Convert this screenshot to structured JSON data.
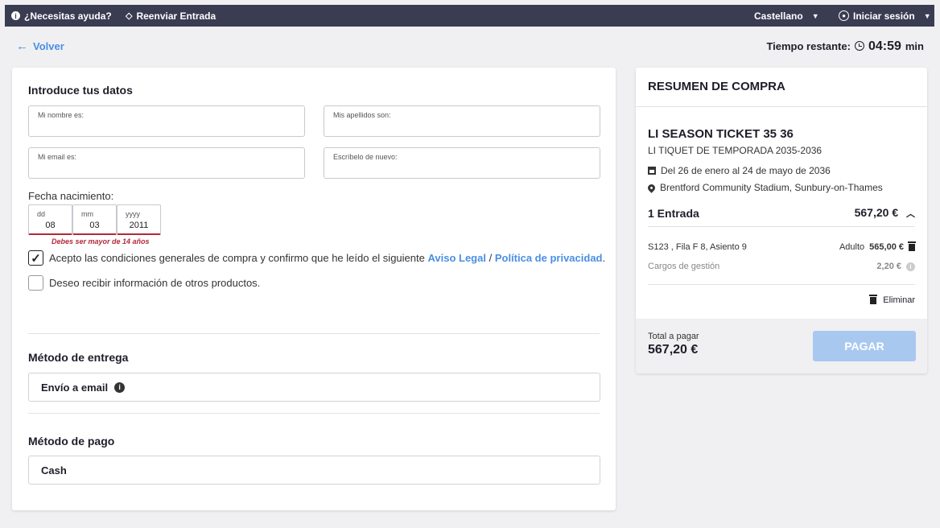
{
  "topbar": {
    "help": "¿Necesitas ayuda?",
    "resend": "Reenviar Entrada",
    "language": "Castellano",
    "login": "Iniciar sesión"
  },
  "nav": {
    "back": "Volver",
    "timer_label": "Tiempo restante:",
    "timer_value": "04:59",
    "timer_unit": "min"
  },
  "form": {
    "title": "Introduce tus datos",
    "first_name_label": "Mi nombre es:",
    "last_name_label": "Mis apellidos son:",
    "email_label": "Mi email es:",
    "email_confirm_label": "Escríbelo de nuevo:",
    "dob_label": "Fecha nacimiento:",
    "dob": {
      "day_label": "dd",
      "day": "08",
      "month_label": "mm",
      "month": "03",
      "year_label": "yyyy",
      "year": "2011"
    },
    "dob_error": "Debes ser mayor de 14 años",
    "terms_text": "Acepto las condiciones generales de compra y confirmo que he leído el siguiente",
    "terms_link_legal": "Aviso Legal",
    "terms_sep": "/",
    "terms_link_privacy": "Política de privacidad",
    "terms_end": ".",
    "newsletter_text": "Deseo recibir información de otros productos."
  },
  "delivery": {
    "title": "Método de entrega",
    "option": "Envío a email"
  },
  "payment": {
    "title": "Método de pago",
    "option": "Cash"
  },
  "summary": {
    "header": "RESUMEN DE COMPRA",
    "event_title": "LI SEASON TICKET 35 36",
    "event_subtitle": "LI TIQUET DE TEMPORADA 2035-2036",
    "dates": "Del 26 de enero al 24 de mayo de 2036",
    "venue": "Brentford Community Stadium, Sunbury-on-Thames",
    "tickets_label": "1 Entrada",
    "tickets_total": "567,20 €",
    "seat": "S123 , Fila F 8, Asiento 9",
    "seat_type": "Adulto",
    "seat_price": "565,00 €",
    "fees_label": "Cargos de gestión",
    "fees_value": "2,20 €",
    "remove": "Eliminar",
    "total_label": "Total a pagar",
    "total_value": "567,20 €",
    "pay_button": "PAGAR"
  }
}
